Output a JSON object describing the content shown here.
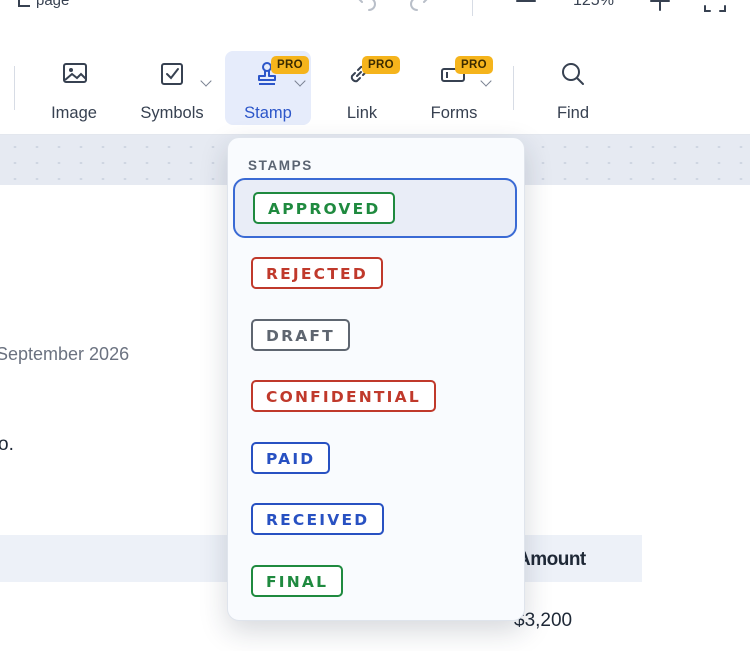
{
  "topbar": {
    "page_label": "page",
    "zoom": "125%"
  },
  "toolbar": {
    "tools": [
      {
        "label": "Image",
        "icon": "image-icon"
      },
      {
        "label": "Symbols",
        "icon": "checkbox-icon"
      },
      {
        "label": "Stamp",
        "icon": "stamp-icon",
        "badge": "PRO",
        "active": true
      },
      {
        "label": "Link",
        "icon": "link-icon",
        "badge": "PRO"
      },
      {
        "label": "Forms",
        "icon": "form-field-icon",
        "badge": "PRO"
      },
      {
        "label": "Find",
        "icon": "search-icon"
      }
    ]
  },
  "document": {
    "date_fragment": "September 2026",
    "text_fragment": "o.",
    "table_header_amount": "Amount",
    "table_cell_amount": "$3,200"
  },
  "stamp_menu": {
    "title": "STAMPS",
    "selected": "APPROVED",
    "stamps": [
      {
        "label": "APPROVED",
        "color": "#1f8a3f"
      },
      {
        "label": "REJECTED",
        "color": "#c0392b"
      },
      {
        "label": "DRAFT",
        "color": "#5f6670"
      },
      {
        "label": "CONFIDENTIAL",
        "color": "#c0392b"
      },
      {
        "label": "PAID",
        "color": "#2851c2"
      },
      {
        "label": "RECEIVED",
        "color": "#2851c2"
      },
      {
        "label": "FINAL",
        "color": "#1f8a3f"
      }
    ]
  }
}
